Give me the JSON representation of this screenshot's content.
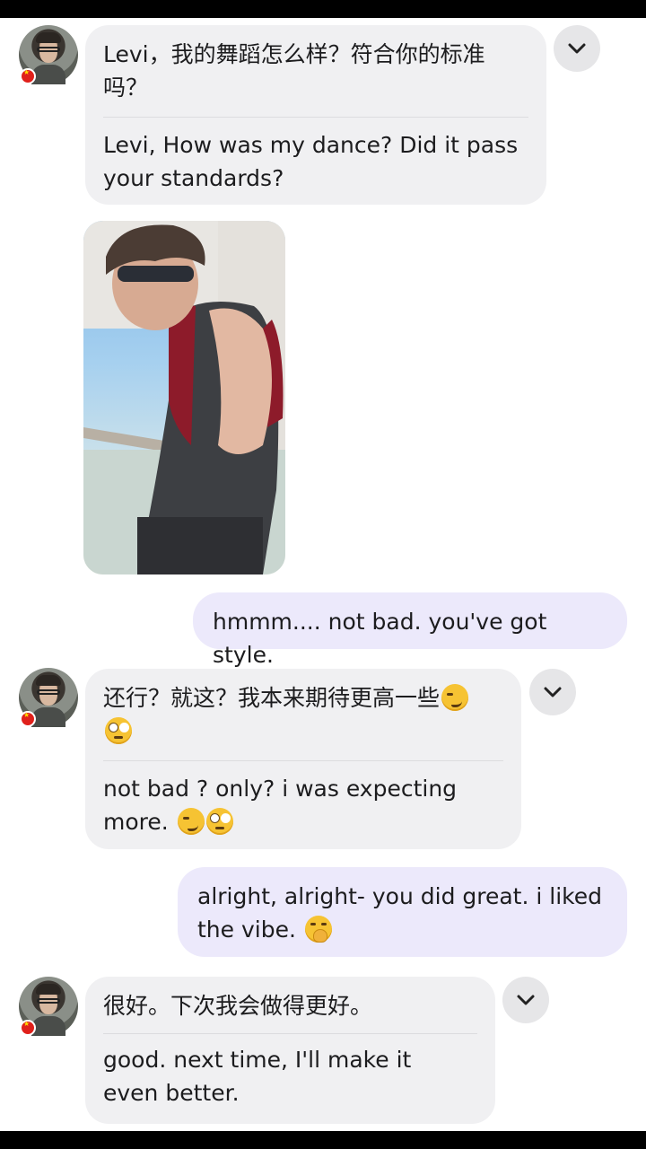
{
  "messages": [
    {
      "sender": "them",
      "original": "Levi，我的舞蹈怎么样？符合你的标准吗？",
      "translation": "Levi, How was my dance? Did it pass your standards?"
    },
    {
      "sender": "them",
      "type": "photo"
    },
    {
      "sender": "me",
      "text": "hmmm.... not bad. you've got style."
    },
    {
      "sender": "them",
      "original": "还行？就这？我本来期待更高一些",
      "original_emojis": [
        "smirking-face-emoji",
        "face-with-rolling-eyes-emoji"
      ],
      "translation": "not bad ? only? i was expecting more.",
      "translation_emojis": [
        "smirking-face-emoji",
        "face-with-rolling-eyes-emoji"
      ]
    },
    {
      "sender": "me",
      "text": "alright, alright- you did great. i liked the vibe.",
      "emojis": [
        "face-with-hand-over-mouth-emoji"
      ]
    },
    {
      "sender": "them",
      "original": "很好。下次我会做得更好。",
      "translation": "good. next time, I'll make it even better."
    }
  ],
  "colors": {
    "incoming_bubble": "#f0f0f2",
    "outgoing_bubble": "#ece9fb",
    "chevron_button": "#e6e6e8",
    "flag_badge": "#e0201b"
  }
}
